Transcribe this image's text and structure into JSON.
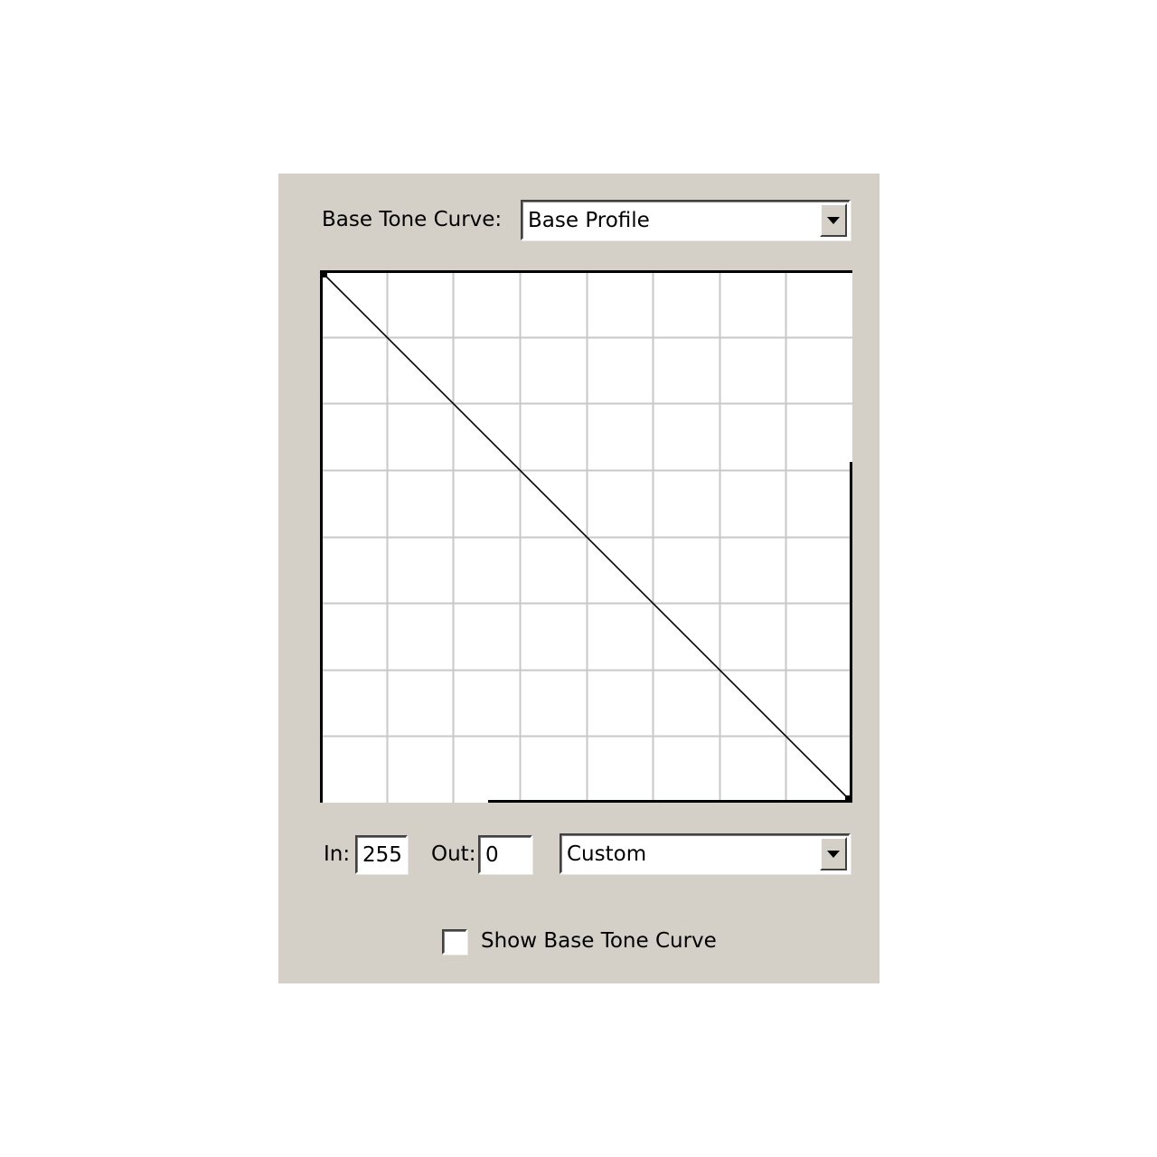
{
  "base_tone_curve": {
    "label": "Base Tone Curve:",
    "selected": "Base Profile"
  },
  "curve": {
    "grid_divisions": 8,
    "range": [
      0,
      255
    ],
    "points": [
      [
        0,
        255
      ],
      [
        255,
        0
      ]
    ],
    "grid_color": "#c8c8c8",
    "line_color": "#000000"
  },
  "in": {
    "label": "In:",
    "value": "255"
  },
  "out": {
    "label": "Out:",
    "value": "0"
  },
  "preset": {
    "selected": "Custom"
  },
  "show_base": {
    "label": "Show Base Tone Curve",
    "checked": false
  }
}
